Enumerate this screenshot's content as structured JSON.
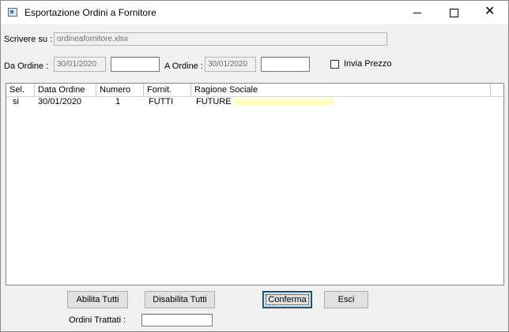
{
  "window": {
    "title": "Esportazione Ordini a Fornitore",
    "minimize_glyph": "minimize-icon",
    "maximize_glyph": "maximize-icon",
    "close_glyph": "✕"
  },
  "form": {
    "output_label": "Scrivere su :",
    "output_value": "ordineafornitore.xlsx",
    "from_label": "Da Ordine :",
    "from_date": "30/01/2020",
    "from_number": "",
    "to_label": "A Ordine :",
    "to_date": "30/01/2020",
    "to_number": "",
    "send_price_label": "Invia Prezzo",
    "send_price_checked": false
  },
  "grid": {
    "columns": [
      "Sel.",
      "Data Ordine",
      "Numero",
      "Fornit.",
      "Ragione Sociale"
    ],
    "rows": [
      [
        "si",
        "30/01/2020",
        "1",
        "FUTTI",
        "FUTURE"
      ]
    ]
  },
  "buttons": {
    "enable_all": "Abilita Tutti",
    "disable_all": "Disabilita Tutti",
    "confirm": "Conferma",
    "exit": "Esci"
  },
  "footer": {
    "processed_label": "Ordini Trattati :",
    "processed_value": ""
  },
  "colors": {
    "window_bg": "#f0f0f0",
    "highlight": "#ffffc0",
    "focus_accent": "#0078d7"
  }
}
